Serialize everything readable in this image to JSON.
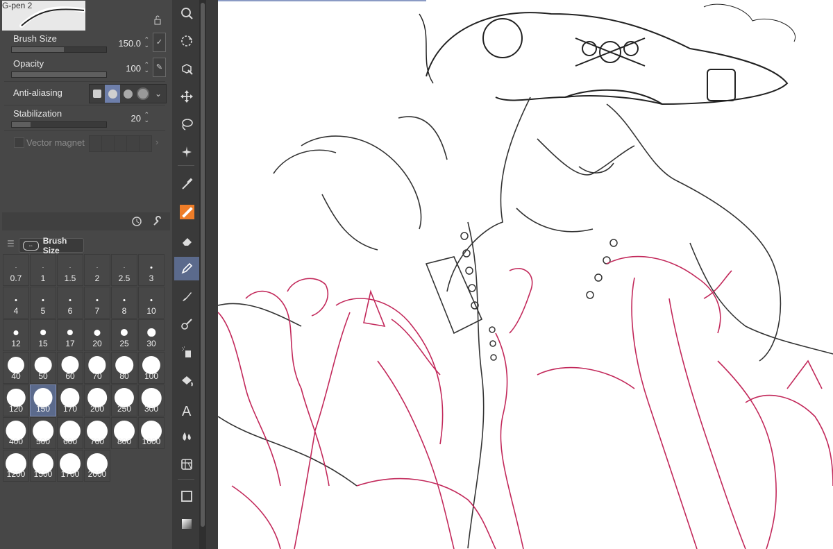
{
  "brush": {
    "name": "G-pen 2"
  },
  "properties": {
    "brush_size": {
      "label": "Brush Size",
      "value": "150.0",
      "fill": 0.55
    },
    "opacity": {
      "label": "Opacity",
      "value": "100",
      "fill": 1.0
    },
    "anti_aliasing": {
      "label": "Anti-aliasing",
      "selected_index": 1
    },
    "stabilization": {
      "label": "Stabilization",
      "value": "20",
      "fill": 0.2
    },
    "vector_magnet": {
      "label": "Vector magnet"
    }
  },
  "brush_size_palette": {
    "tab_label": "Brush Size",
    "sizes": [
      "0.7",
      "1",
      "1.5",
      "2",
      "2.5",
      "3",
      "4",
      "5",
      "6",
      "7",
      "8",
      "10",
      "12",
      "15",
      "17",
      "20",
      "25",
      "30",
      "40",
      "50",
      "60",
      "70",
      "80",
      "100",
      "120",
      "150",
      "170",
      "200",
      "250",
      "300",
      "400",
      "500",
      "600",
      "700",
      "800",
      "1000",
      "1200",
      "1500",
      "1700",
      "2000"
    ],
    "selected": "150"
  },
  "tools": [
    {
      "name": "zoom-tool",
      "icon": "magnifier-icon"
    },
    {
      "name": "rotate-tool",
      "icon": "rotate-icon"
    },
    {
      "name": "operation-tool",
      "icon": "cube-cursor-icon"
    },
    {
      "name": "move-tool",
      "icon": "move-arrows-icon"
    },
    {
      "name": "lasso-tool",
      "icon": "lasso-icon"
    },
    {
      "name": "magic-wand-tool",
      "icon": "magic-wand-icon"
    },
    {
      "name": "eyedropper-tool",
      "icon": "eyedropper-icon"
    },
    {
      "name": "pen-tool",
      "icon": "pen-icon"
    },
    {
      "name": "eraser-tool",
      "icon": "eraser-icon"
    },
    {
      "name": "pencil-tool",
      "icon": "pencil-icon"
    },
    {
      "name": "brush-tool",
      "icon": "brush-icon"
    },
    {
      "name": "decoration-tool",
      "icon": "decoration-icon"
    },
    {
      "name": "airbrush-tool",
      "icon": "airbrush-icon"
    },
    {
      "name": "fill-tool",
      "icon": "bucket-icon"
    },
    {
      "name": "text-tool",
      "icon": "text-icon"
    },
    {
      "name": "blend-tool",
      "icon": "droplets-icon"
    },
    {
      "name": "frame-tool",
      "icon": "frame-grid-icon"
    },
    {
      "name": "figure-tool",
      "icon": "rectangle-icon"
    },
    {
      "name": "gradient-tool",
      "icon": "gradient-icon"
    }
  ],
  "colors": {
    "accent": "#6e7fab",
    "pen_orange": "#ef7d28",
    "sketch_red": "#c2285a"
  }
}
